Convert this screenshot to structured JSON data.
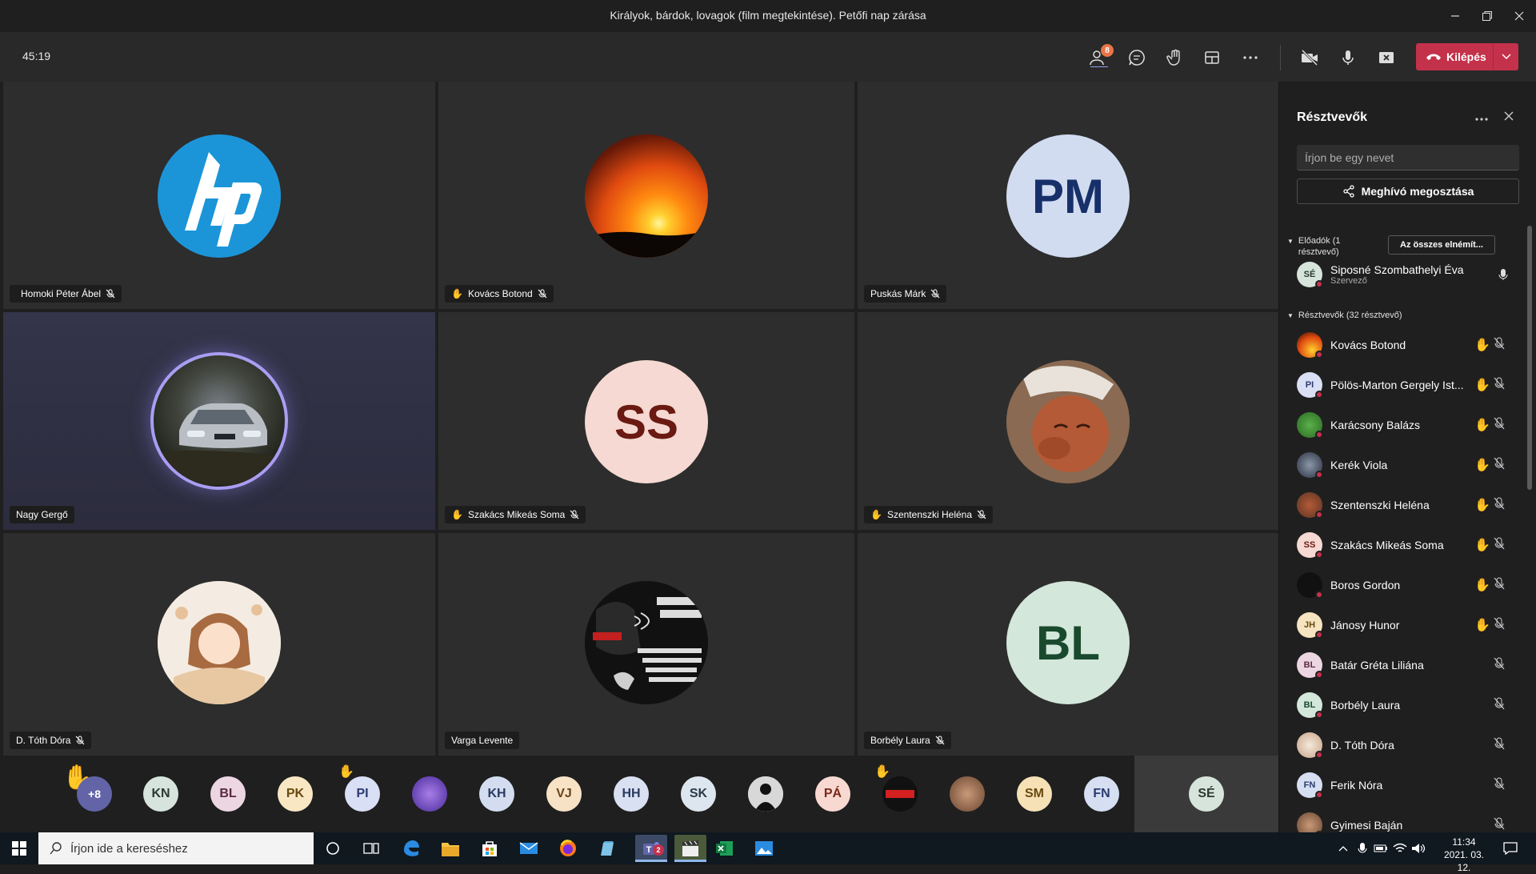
{
  "window": {
    "title": "Királyok, bárdok, lovagok (film megtekintése). Petőfi nap zárása"
  },
  "toolbar": {
    "timer": "45:19",
    "participants_badge": "8",
    "leave_label": "Kilépés"
  },
  "tiles": [
    {
      "name": "Homoki Péter Ábel",
      "avatar_text": "",
      "hand": "",
      "muted": true
    },
    {
      "name": "Kovács Botond",
      "avatar_text": "",
      "hand": "✋",
      "muted": true
    },
    {
      "name": "Puskás Márk",
      "avatar_text": "PM",
      "hand": "",
      "muted": true
    },
    {
      "name": "Nagy Gergő",
      "avatar_text": "",
      "hand": "",
      "muted": false
    },
    {
      "name": "Szakács Mikeás Soma",
      "avatar_text": "SS",
      "hand": "✋",
      "muted": true
    },
    {
      "name": "Szentenszki Heléna",
      "avatar_text": "",
      "hand": "✋",
      "muted": true
    },
    {
      "name": "D. Tóth Dóra",
      "avatar_text": "",
      "hand": "",
      "muted": true
    },
    {
      "name": "Varga Levente",
      "avatar_text": "",
      "hand": "",
      "muted": false
    },
    {
      "name": "Borbély Laura",
      "avatar_text": "BL",
      "hand": "",
      "muted": true
    }
  ],
  "strip": {
    "overflow": "+8",
    "hand": "✋",
    "avatars": [
      "KN",
      "BL",
      "PK",
      "PI",
      "",
      "KH",
      "VJ",
      "HH",
      "SK",
      "",
      "PÁ",
      "",
      "",
      "SM",
      "FN"
    ],
    "self": "SÉ"
  },
  "panel": {
    "title": "Résztvevők",
    "search_placeholder": "Írjon be egy nevet",
    "share_label": "Meghívó megosztása",
    "presenters_heading": "Előadók (1 résztvevő)",
    "mute_all_label": "Az összes elnémít...",
    "presenter": {
      "initials": "SÉ",
      "name": "Siposné Szombathelyi Éva",
      "role": "Szervező"
    },
    "attendees_heading": "Résztvevők (32 résztvevő)",
    "attendees": [
      {
        "initials": "",
        "name": "Kovács Botond",
        "hand": "✋"
      },
      {
        "initials": "PI",
        "name": "Pölös-Marton Gergely Ist...",
        "hand": "✋"
      },
      {
        "initials": "",
        "name": "Karácsony Balázs",
        "hand": "✋"
      },
      {
        "initials": "",
        "name": "Kerék Viola",
        "hand": "✋"
      },
      {
        "initials": "",
        "name": "Szentenszki Heléna",
        "hand": "✋"
      },
      {
        "initials": "SS",
        "name": "Szakács Mikeás Soma",
        "hand": "✋"
      },
      {
        "initials": "",
        "name": "Boros Gordon",
        "hand": "✋"
      },
      {
        "initials": "JH",
        "name": "Jánosy Hunor",
        "hand": "✋"
      },
      {
        "initials": "BL",
        "name": "Batár Gréta Liliána",
        "hand": ""
      },
      {
        "initials": "BL",
        "name": "Borbély Laura",
        "hand": ""
      },
      {
        "initials": "",
        "name": "D. Tóth Dóra",
        "hand": ""
      },
      {
        "initials": "FN",
        "name": "Ferik Nóra",
        "hand": ""
      },
      {
        "initials": "",
        "name": "Gyimesi Baján",
        "hand": ""
      }
    ]
  },
  "taskbar": {
    "search_placeholder": "Írjon ide a kereséshez",
    "time": "11:34",
    "date": "2021. 03. 12.",
    "teams_badge": "2"
  },
  "colors": {
    "leave": "#c4314b",
    "badge": "#e97548",
    "offline_dot": "#c4314b",
    "hand": "#f2b53b",
    "taskbar": "#101820"
  }
}
